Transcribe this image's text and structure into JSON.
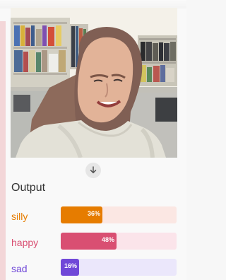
{
  "output": {
    "title": "Output",
    "arrow_icon": "arrow-down-icon",
    "classes": [
      {
        "label": "silly",
        "value_text": "36%",
        "value": 0.36,
        "color": "#e67c00",
        "track_color": "#fbe7e3"
      },
      {
        "label": "happy",
        "value_text": "48%",
        "value": 0.48,
        "color": "#d94f72",
        "track_color": "#fbe4ea"
      },
      {
        "label": "sad",
        "value_text": "16%",
        "value": 0.16,
        "color": "#7048d8",
        "track_color": "#ebe7fb"
      }
    ]
  }
}
